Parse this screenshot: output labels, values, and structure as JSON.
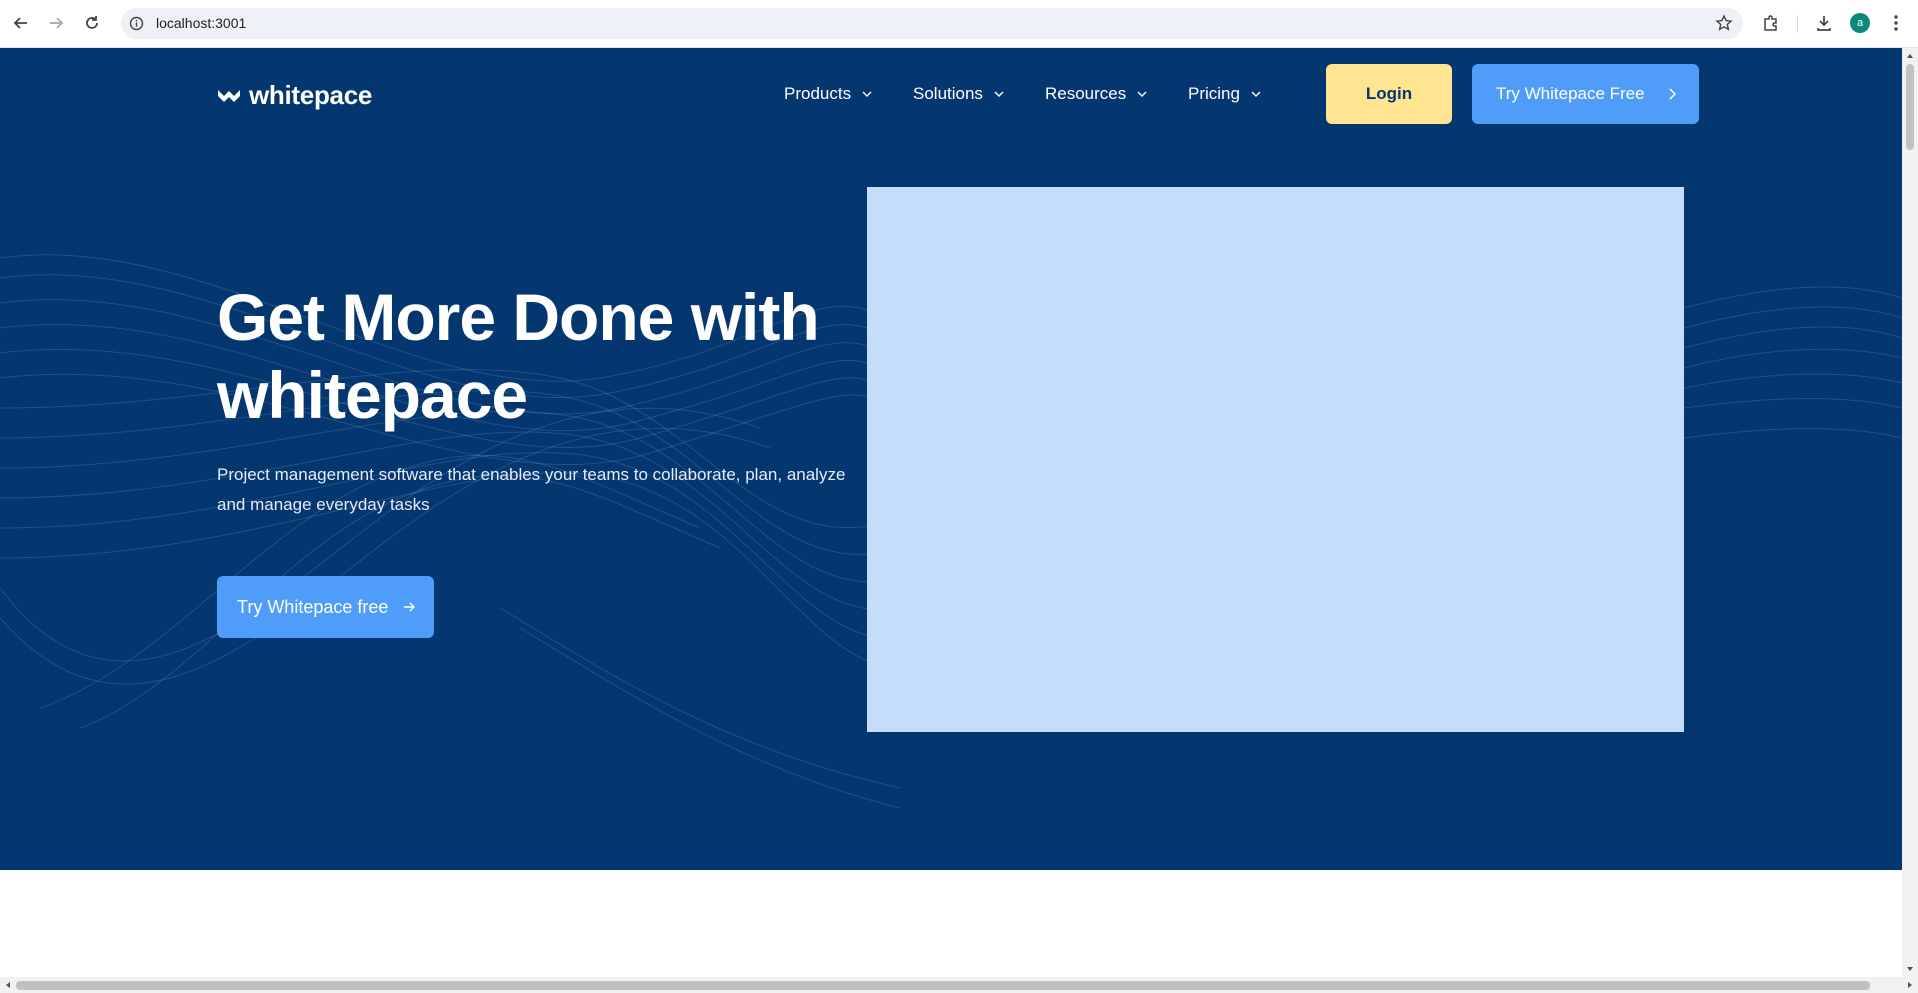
{
  "browser": {
    "url": "localhost:3001",
    "profile_initial": "a",
    "icons": [
      "back-icon",
      "forward-icon",
      "reload-icon",
      "site-info-icon",
      "bookmark-star-icon",
      "extensions-icon",
      "downloads-icon",
      "more-vert-icon"
    ]
  },
  "header": {
    "logo_text": "whitepace",
    "nav": [
      {
        "label": "Products"
      },
      {
        "label": "Solutions"
      },
      {
        "label": "Resources"
      },
      {
        "label": "Pricing"
      }
    ],
    "login_label": "Login",
    "try_label": "Try Whitepace Free"
  },
  "hero": {
    "headline_line1": "Get More Done with",
    "headline_line2": "whitepace",
    "subtext": "Project management software that enables your teams to collaborate, plan, analyze and manage everyday tasks",
    "cta_label": "Try Whitepace free"
  },
  "colors": {
    "hero_bg": "#04366f",
    "accent_blue": "#4f9cf9",
    "login_yellow": "#ffe492",
    "media_placeholder": "#c5ddfa"
  }
}
